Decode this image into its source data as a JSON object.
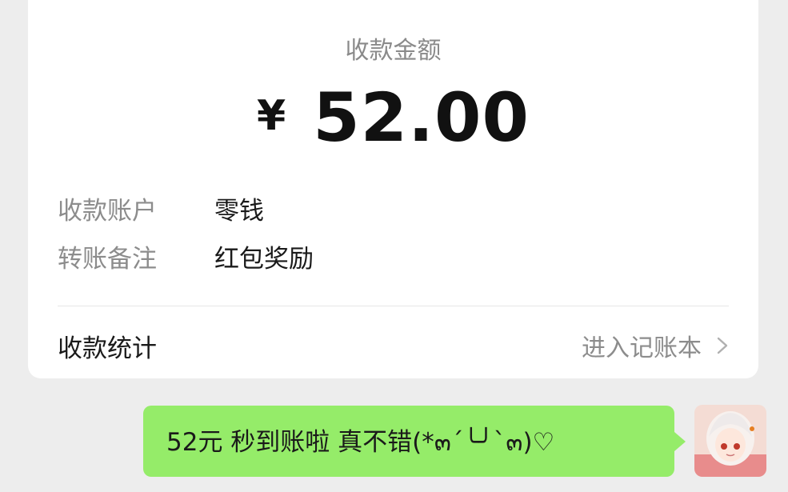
{
  "receipt": {
    "caption": "收款金额",
    "currency_symbol": "¥",
    "amount": "52.00",
    "rows": [
      {
        "key": "收款账户",
        "value": "零钱"
      },
      {
        "key": "转账备注",
        "value": "红包奖励"
      }
    ],
    "stats_label": "收款统计",
    "stats_link": "进入记账本"
  },
  "chat": {
    "message": "52元 秒到账啦 真不错(*๓´╰╯`๓)♡"
  },
  "colors": {
    "background": "#ededed",
    "bubble": "#95ec69"
  },
  "icons": {
    "chevron": "chevron-right-icon",
    "avatar": "avatar"
  }
}
